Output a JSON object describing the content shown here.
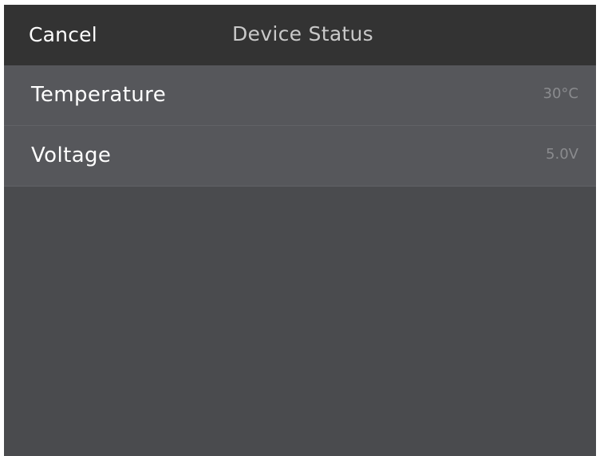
{
  "navbar": {
    "cancel_label": "Cancel",
    "title": "Device Status"
  },
  "status": {
    "rows": [
      {
        "label": "Temperature",
        "value": "30°C"
      },
      {
        "label": "Voltage",
        "value": "5.0V"
      }
    ]
  },
  "colors": {
    "navbar_background": "#333333",
    "row_background": "#56575b",
    "screen_background": "#4a4b4e",
    "value_text": "#8a8b8e"
  }
}
